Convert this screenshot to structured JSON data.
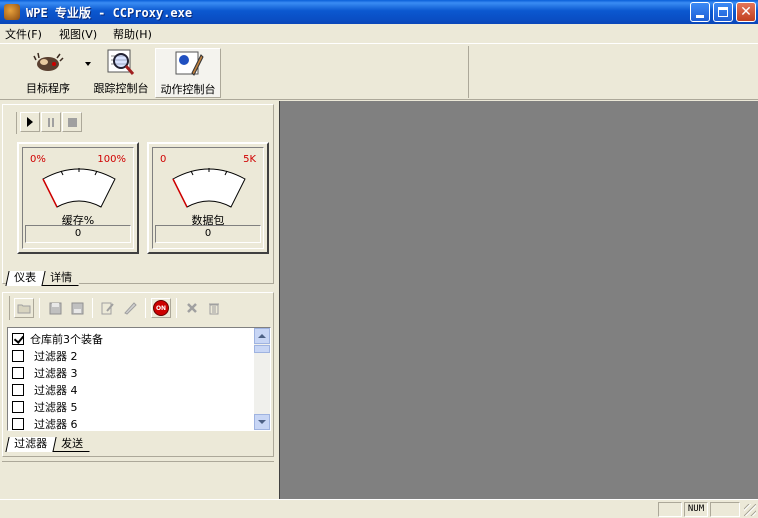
{
  "window": {
    "title": "WPE 专业版 - CCProxy.exe"
  },
  "menu": {
    "file": "文件(F)",
    "view": "视图(V)",
    "help": "帮助(H)"
  },
  "toolbar": {
    "target_label": "目标程序",
    "trace_label": "跟踪控制台",
    "action_label": "动作控制台"
  },
  "gauges": [
    {
      "min_label": "0%",
      "max_label": "100%",
      "label": "缓存%",
      "value": "0"
    },
    {
      "min_label": "0",
      "max_label": "5K",
      "label": "数据包",
      "value": "0"
    }
  ],
  "top_tabs": [
    "仪表",
    "详情"
  ],
  "filters": [
    {
      "label": "仓库前3个装备",
      "checked": true
    },
    {
      "label": "过滤器 2",
      "checked": false
    },
    {
      "label": "过滤器 3",
      "checked": false
    },
    {
      "label": "过滤器 4",
      "checked": false
    },
    {
      "label": "过滤器 5",
      "checked": false
    },
    {
      "label": "过滤器 6",
      "checked": false
    }
  ],
  "bottom_tabs": [
    "过滤器",
    "发送"
  ],
  "status": {
    "num": "NUM"
  },
  "colors": {
    "titlebar": "#0a5fd8",
    "workspace": "#808080",
    "panel": "#ece9d8",
    "gauge_limit": "#d00000"
  }
}
